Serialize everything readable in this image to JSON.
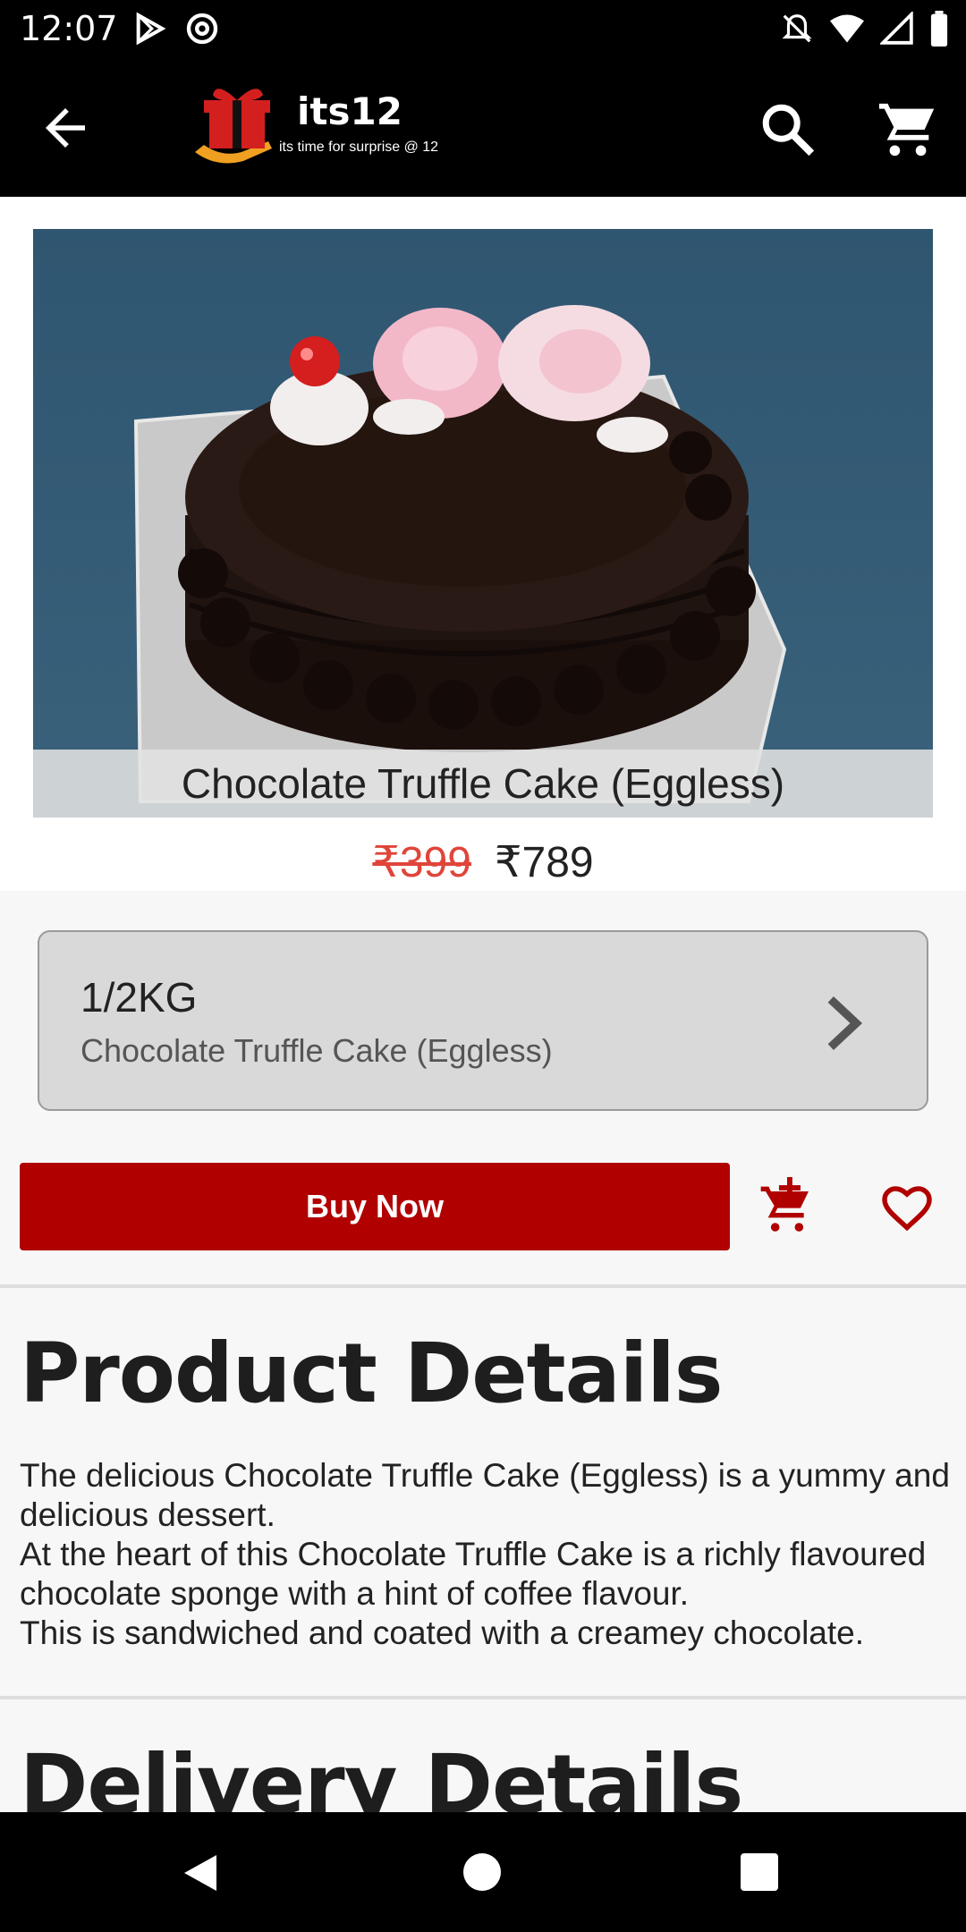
{
  "status_bar": {
    "time": "12:07",
    "left_icons": [
      "play-store-icon",
      "data-saver-icon"
    ],
    "right_icons": [
      "notifications-off-icon",
      "wifi-icon",
      "signal-icon",
      "battery-icon"
    ]
  },
  "app_bar": {
    "logo_title": "its12",
    "logo_tagline": "its time for surprise @ 12",
    "icons": [
      "back-arrow-icon",
      "search-icon",
      "cart-icon"
    ]
  },
  "product": {
    "image_caption": "Chocolate Truffle Cake (Eggless)",
    "old_price": "₹399",
    "new_price": "₹789",
    "variant": {
      "size": "1/2KG",
      "name": "Chocolate Truffle Cake (Eggless)"
    }
  },
  "actions": {
    "buy_now_label": "Buy Now",
    "add_to_cart_icon": "add-to-cart-icon",
    "wishlist_icon": "heart-icon"
  },
  "product_details": {
    "title": "Product Details",
    "lines": [
      "The delicious Chocolate Truffle Cake (Eggless) is a yummy and delicious dessert.",
      "At the heart of this Chocolate Truffle Cake is a richly flavoured chocolate sponge with a hint of coffee flavour.",
      "This is sandwiched and coated with a creamey chocolate."
    ]
  },
  "delivery_details": {
    "title": "Delivery Details"
  },
  "colors": {
    "buy_button": "#b10000",
    "old_price": "#e0453a",
    "app_bar": "#000000"
  }
}
